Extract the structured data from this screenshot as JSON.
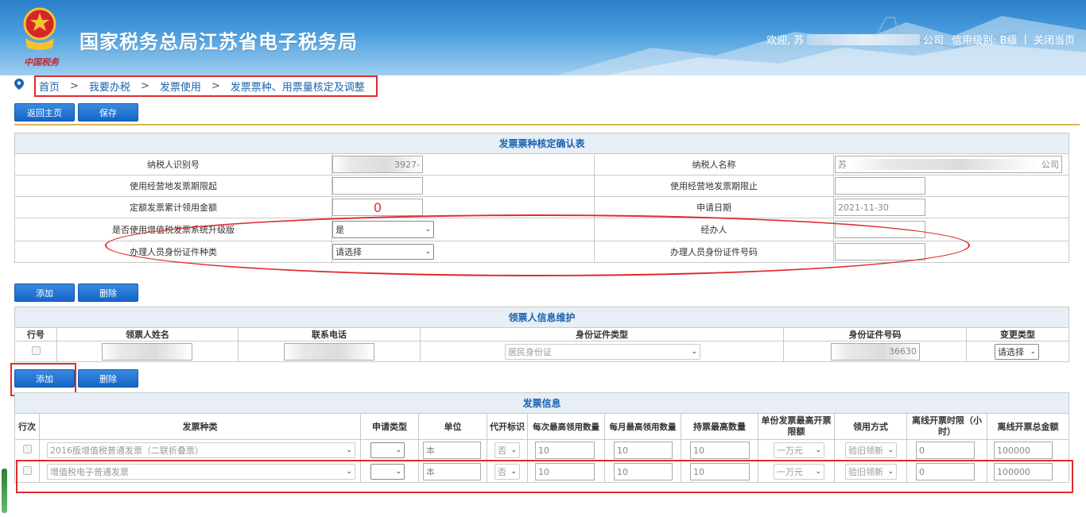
{
  "header": {
    "site_title": "国家税务总局江苏省电子税务局",
    "emblem_text": "中国税务",
    "welcome": "欢迎,",
    "company_prefix": "苏",
    "company_suffix": "公司",
    "credit_level": "信用级别: B级",
    "close_label": "关闭当页"
  },
  "breadcrumb": [
    "首页",
    "我要办税",
    "发票使用",
    "发票票种、用票量核定及调整"
  ],
  "breadcrumb_sep": ">",
  "toolbar": {
    "back_label": "返回主页",
    "save_label": "保存"
  },
  "confirm_table": {
    "title": "发票票种核定确认表",
    "rows": [
      {
        "l1": "纳税人识别号",
        "v1": "3927-",
        "l2": "纳税人名称",
        "v2_prefix": "苏",
        "v2_suffix": "公司"
      },
      {
        "l1": "使用经营地发票期限起",
        "v1": "",
        "l2": "使用经营地发票期限止",
        "v2": ""
      },
      {
        "l1": "定额发票累计领用金额",
        "v1": "0",
        "l2": "申请日期",
        "v2": "2021-11-30"
      },
      {
        "l1": "是否使用增值税发票系统升级版",
        "v1": "是",
        "l2": "经办人",
        "v2": ""
      },
      {
        "l1": "办理人员身份证件种类",
        "v1": "请选择",
        "l2": "办理人员身份证件号码",
        "v2": ""
      }
    ]
  },
  "ticket_actions": {
    "add_label": "添加",
    "delete_label": "删除"
  },
  "ticket_table": {
    "title": "领票人信息维护",
    "headers": [
      "行号",
      "领票人姓名",
      "联系电话",
      "身份证件类型",
      "身份证件号码",
      "变更类型"
    ],
    "row": {
      "id_type": "居民身份证",
      "id_no_tail": "36630",
      "change_type": "请选择"
    }
  },
  "invoice_actions": {
    "add_label": "添加",
    "delete_label": "删除"
  },
  "invoice_table": {
    "title": "发票信息",
    "headers": [
      "行次",
      "发票种类",
      "申请类型",
      "单位",
      "代开标识",
      "每次最高领用数量",
      "每月最高领用数量",
      "持票最高数量",
      "单份发票最高开票限额",
      "领用方式",
      "离线开票时限（小时）",
      "离线开票总金额"
    ],
    "rows": [
      {
        "kind": "2016版增值税普通发票（二联折叠票）",
        "apply_type": "",
        "unit": "本",
        "proxy": "否",
        "per_time": "10",
        "per_month": "10",
        "hold_max": "10",
        "limit": "一万元",
        "method": "验旧领新",
        "offline_hours": "0",
        "offline_amount": "100000"
      },
      {
        "kind": "增值税电子普通发票",
        "apply_type": "",
        "unit": "本",
        "proxy": "否",
        "per_time": "10",
        "per_month": "10",
        "hold_max": "10",
        "limit": "一万元",
        "method": "验旧领新",
        "offline_hours": "0",
        "offline_amount": "100000"
      }
    ]
  }
}
